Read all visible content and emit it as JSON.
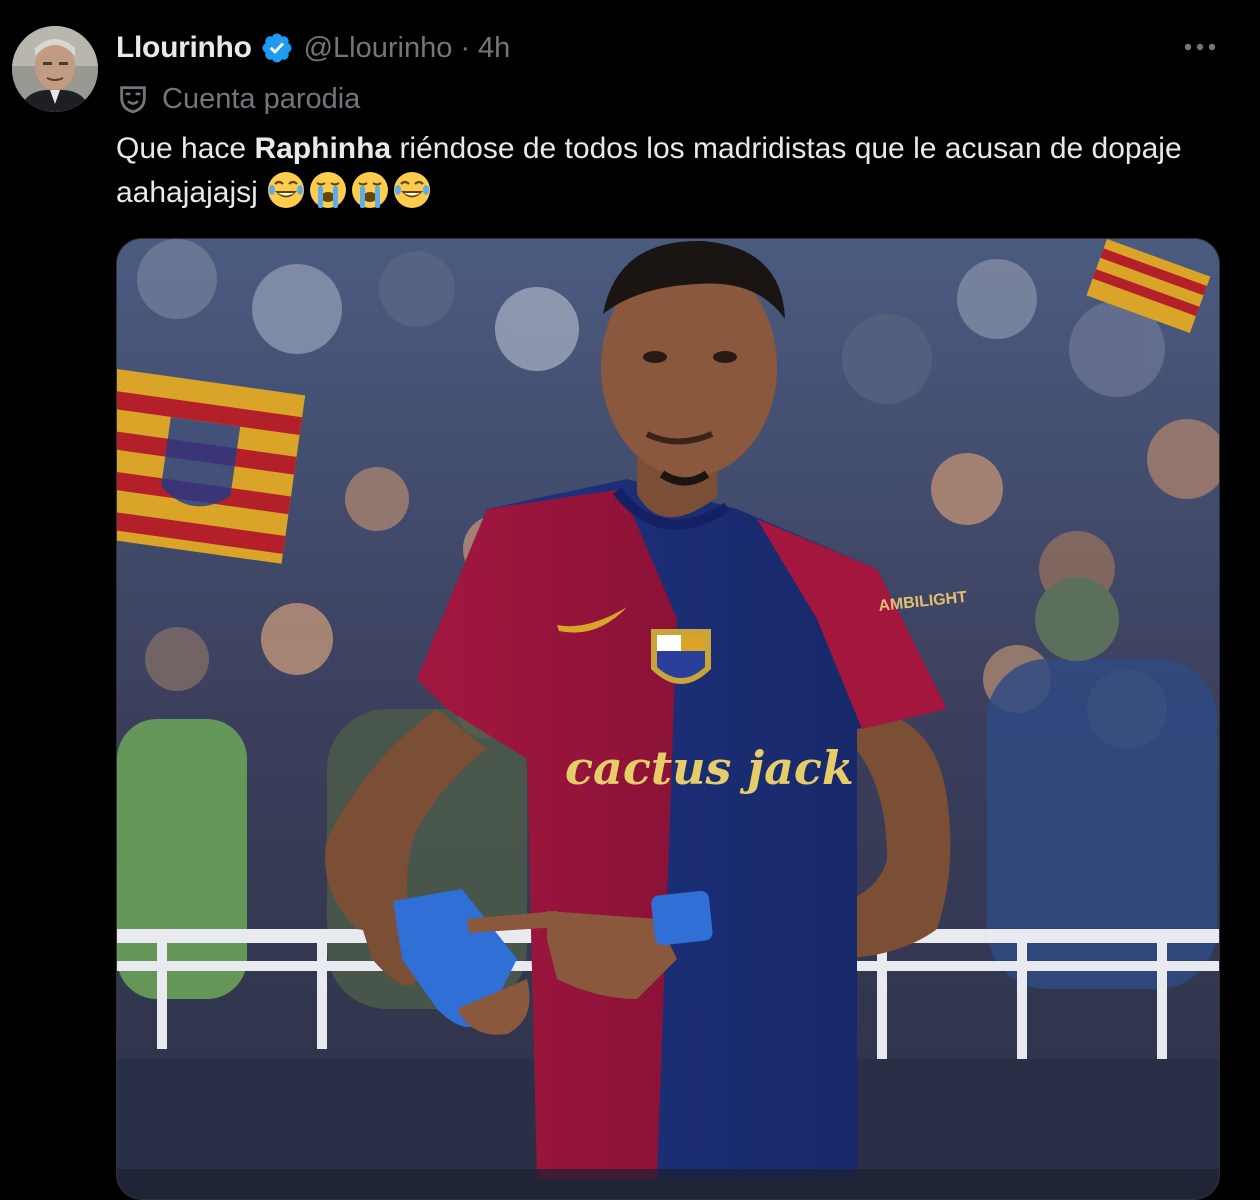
{
  "tweet": {
    "author": {
      "display_name": "Llourinho",
      "handle": "@Llourinho",
      "verified": true,
      "verified_color": "#1d9bf0"
    },
    "separator": "·",
    "time": "4h",
    "parody_label": "Cuenta parodia",
    "text": {
      "part1": "Que hace ",
      "bold": "Raphinha",
      "part2": " riéndose de todos los madridistas que le acusan de dopaje aahajajajsj",
      "emojis": [
        "joy-emoji",
        "sob-emoji",
        "sob-emoji",
        "joy-emoji"
      ]
    },
    "media": {
      "jersey_sleeve_text": "AMBILIGHT",
      "jersey_sponsor_text": "cactus jack"
    }
  },
  "icons": {
    "more": "more-horizontal-icon",
    "parody": "parody-mask-icon",
    "verified": "verified-badge-icon"
  },
  "colors": {
    "background": "#000000",
    "primary_text": "#e7e9ea",
    "secondary_text": "#71767b",
    "accent": "#1d9bf0"
  }
}
